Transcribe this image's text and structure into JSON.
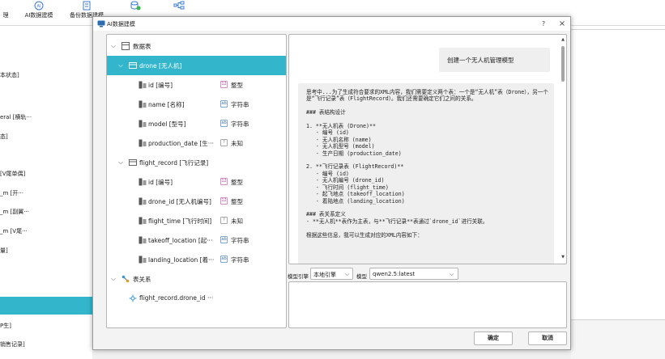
{
  "toolbar": {
    "items": [
      {
        "label": "理",
        "icon": "partial-icon"
      },
      {
        "label": "AI数据建模",
        "icon": "ai-icon"
      },
      {
        "label": "备份数据建模",
        "icon": "backup-icon"
      },
      {
        "label": "",
        "icon": "database-check-icon"
      },
      {
        "label": "",
        "icon": "tree-icon"
      }
    ]
  },
  "left_panel": {
    "items": [
      "本状态]",
      "eral [横轨···",
      "态]",
      "[V尾单偶]",
      "_m [开···",
      "_m [副翼···",
      "_m [V尾···",
      "量]",
      "P生]",
      "销售记录]"
    ]
  },
  "dialog": {
    "title": "AI数据建模",
    "help": "?",
    "close": "×",
    "tree": {
      "root_label": "数据表",
      "tables": [
        {
          "label": "drone [无人机]",
          "selected": true,
          "fields": [
            {
              "name": "id [编号]",
              "type": "整型",
              "type_icon": "number-type-icon"
            },
            {
              "name": "name [名称]",
              "type": "字符串",
              "type_icon": "string-type-icon"
            },
            {
              "name": "model [型号]",
              "type": "字符串",
              "type_icon": "string-type-icon"
            },
            {
              "name": "production_date [生···",
              "type": "未知",
              "type_icon": "unknown-type-icon"
            }
          ]
        },
        {
          "label": "flight_record [飞行记录]",
          "selected": false,
          "fields": [
            {
              "name": "id [编号]",
              "type": "整型",
              "type_icon": "number-type-icon"
            },
            {
              "name": "drone_id [无人机编号]",
              "type": "整型",
              "type_icon": "number-type-icon"
            },
            {
              "name": "flight_time [飞行时间]",
              "type": "未知",
              "type_icon": "unknown-type-icon"
            },
            {
              "name": "takeoff_location [起···",
              "type": "字符串",
              "type_icon": "string-type-icon"
            },
            {
              "name": "landing_location [着···",
              "type": "字符串",
              "type_icon": "string-type-icon"
            }
          ]
        }
      ],
      "relations_label": "表关系",
      "relations": [
        "flight_record.drone_id ···"
      ]
    },
    "chat": {
      "user_message": "创建一个无人机管理模型",
      "ai_message": "思考中...为了生成符合要求的XML内容，我们需要定义两个表：一个是“无人机”表（Drone），另一个是“飞行记录”表（FlightRecord）。我们还需要确定它们之间的关系。\n\n### 表结构设计\n\n1. **无人机表 (Drone)**\n   - 编号 (id)\n   - 无人机名称 (name)\n   - 无人机型号 (model)\n   - 生产日期 (production_date)\n\n2. **飞行记录表 (FlightRecord)**\n   - 编号 (id)\n   - 无人机编号 (drone_id)\n   - 飞行时间 (flight_time)\n   - 起飞地点 (takeoff_location)\n   - 着陆地点 (landing_location)\n\n### 表关系定义\n- **无人机**表作为主表，与**飞行记录**表通过`drone_id`进行关联。\n\n根据这些信息，我可以生成对应的XML内容如下："
    },
    "model_engine_label": "模型引擎",
    "model_engine_value": "本地引擎",
    "model_label": "模型",
    "model_value": "qwen2.5:latest",
    "confirm_label": "确定",
    "cancel_label": "取消"
  },
  "colors": {
    "selection": "#33b6cc",
    "dialog_bg": "#f3f3f3",
    "bubble_bg": "#efefef"
  }
}
